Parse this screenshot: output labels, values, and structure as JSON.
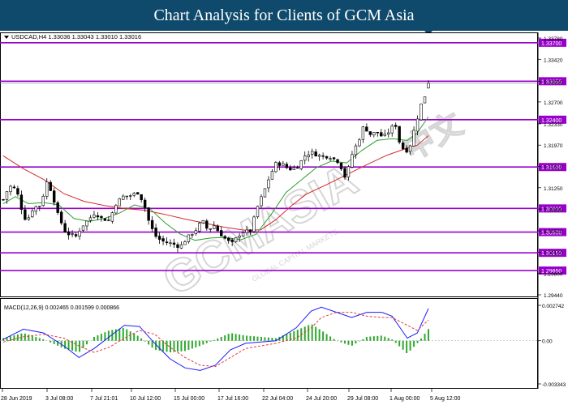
{
  "banner": {
    "title": "Chart Analysis for Clients of GCM Asia"
  },
  "watermark": {
    "brand": "GCMASIA",
    "tagline": "GLOBAL CAPITAL MARKETS",
    "chinese": "中文"
  },
  "price_chart": {
    "header": "USDCAD,H4  1.33036 1.33043 1.33010 1.33016",
    "axis_ticks": [
      "1.33780",
      "1.33420",
      "1.33050",
      "1.32700",
      "1.32330",
      "1.31970",
      "1.31610",
      "1.31250",
      "1.30890",
      "1.30520",
      "1.30160",
      "1.29800",
      "1.29440"
    ],
    "levels": [
      {
        "label": "1.33700",
        "value": 1.337
      },
      {
        "label": "1.33050",
        "value": 1.3305
      },
      {
        "label": "1.32400",
        "value": 1.324
      },
      {
        "label": "1.31600",
        "value": 1.316
      },
      {
        "label": "1.30900",
        "value": 1.309
      },
      {
        "label": "1.30500",
        "value": 1.305
      },
      {
        "label": "1.30150",
        "value": 1.3015
      },
      {
        "label": "1.29850",
        "value": 1.2985
      }
    ],
    "current_price": "1.33016"
  },
  "macd_panel": {
    "header": "MACD(12,26,9) 0.002465 0.001599 0.000866",
    "axis_ticks": [
      "0.002742",
      "0.00",
      "-0.003343"
    ]
  },
  "time_axis": [
    "28 Jun 2019",
    "3 Jul 08:00",
    "7 Jul 21:01",
    "10 Jul 12:00",
    "15 Jul 00:00",
    "17 Jul 16:00",
    "22 Jul 04:00",
    "24 Jul 20:00",
    "29 Jul 08:00",
    "1 Aug 00:00",
    "5 Aug 12:00"
  ],
  "colors": {
    "banner": "#0f4a6c",
    "level_line": "#9900cc",
    "ma_fast": "#2e9e2e",
    "ma_slow": "#d42a2a",
    "macd_main": "#1a1aff",
    "macd_signal": "#e23b3b",
    "histogram": "#2ea82e"
  },
  "chart_data": {
    "type": "candlestick",
    "symbol": "USDCAD",
    "timeframe": "H4",
    "ohlc_last": {
      "open": 1.33036,
      "high": 1.33043,
      "low": 1.3301,
      "close": 1.33016
    },
    "close_path": [
      [
        0,
        1.3105
      ],
      [
        6,
        1.3128
      ],
      [
        13,
        1.3122
      ],
      [
        18,
        1.309
      ],
      [
        23,
        1.3067
      ],
      [
        30,
        1.3092
      ],
      [
        37,
        1.3095
      ],
      [
        43,
        1.3135
      ],
      [
        48,
        1.3118
      ],
      [
        54,
        1.308
      ],
      [
        62,
        1.3048
      ],
      [
        72,
        1.3043
      ],
      [
        78,
        1.306
      ],
      [
        85,
        1.3072
      ],
      [
        91,
        1.3083
      ],
      [
        96,
        1.3074
      ],
      [
        105,
        1.3069
      ],
      [
        111,
        1.3097
      ],
      [
        118,
        1.311
      ],
      [
        126,
        1.3112
      ],
      [
        133,
        1.3117
      ],
      [
        139,
        1.31
      ],
      [
        145,
        1.3063
      ],
      [
        152,
        1.304
      ],
      [
        160,
        1.3033
      ],
      [
        168,
        1.303
      ],
      [
        175,
        1.3025
      ],
      [
        183,
        1.3042
      ],
      [
        190,
        1.3052
      ],
      [
        197,
        1.307
      ],
      [
        203,
        1.3052
      ],
      [
        208,
        1.3063
      ],
      [
        213,
        1.3051
      ],
      [
        219,
        1.304
      ],
      [
        226,
        1.303
      ],
      [
        236,
        1.305
      ],
      [
        245,
        1.3052
      ],
      [
        251,
        1.309
      ],
      [
        258,
        1.3118
      ],
      [
        264,
        1.3145
      ],
      [
        270,
        1.3166
      ],
      [
        277,
        1.3164
      ],
      [
        283,
        1.3156
      ],
      [
        291,
        1.316
      ],
      [
        299,
        1.318
      ],
      [
        305,
        1.3185
      ],
      [
        311,
        1.318
      ],
      [
        317,
        1.3178
      ],
      [
        323,
        1.3178
      ],
      [
        331,
        1.317
      ],
      [
        336,
        1.3155
      ],
      [
        339,
        1.314
      ],
      [
        346,
        1.3185
      ],
      [
        352,
        1.3205
      ],
      [
        357,
        1.323
      ],
      [
        363,
        1.3215
      ],
      [
        370,
        1.3219
      ],
      [
        376,
        1.321
      ],
      [
        382,
        1.322
      ],
      [
        388,
        1.3235
      ],
      [
        393,
        1.3197
      ],
      [
        398,
        1.3187
      ],
      [
        402,
        1.319
      ],
      [
        405,
        1.3212
      ],
      [
        409,
        1.3235
      ],
      [
        413,
        1.3263
      ],
      [
        416,
        1.3274
      ],
      [
        419,
        1.3287
      ],
      [
        421,
        1.33
      ]
    ],
    "ma_fast": [
      [
        0,
        1.3098
      ],
      [
        12,
        1.311
      ],
      [
        25,
        1.3098
      ],
      [
        40,
        1.31
      ],
      [
        55,
        1.3096
      ],
      [
        70,
        1.3073
      ],
      [
        85,
        1.3068
      ],
      [
        100,
        1.3073
      ],
      [
        115,
        1.3082
      ],
      [
        130,
        1.3096
      ],
      [
        145,
        1.309
      ],
      [
        160,
        1.3066
      ],
      [
        175,
        1.3047
      ],
      [
        190,
        1.3036
      ],
      [
        205,
        1.304
      ],
      [
        220,
        1.3041
      ],
      [
        235,
        1.3037
      ],
      [
        250,
        1.3046
      ],
      [
        265,
        1.3079
      ],
      [
        280,
        1.3117
      ],
      [
        295,
        1.3138
      ],
      [
        310,
        1.3159
      ],
      [
        325,
        1.317
      ],
      [
        340,
        1.3167
      ],
      [
        355,
        1.3188
      ],
      [
        370,
        1.3205
      ],
      [
        385,
        1.3208
      ],
      [
        400,
        1.3205
      ],
      [
        410,
        1.3218
      ],
      [
        421,
        1.3245
      ]
    ],
    "ma_slow": [
      [
        0,
        1.3179
      ],
      [
        20,
        1.3157
      ],
      [
        40,
        1.3139
      ],
      [
        60,
        1.3115
      ],
      [
        80,
        1.3102
      ],
      [
        100,
        1.3095
      ],
      [
        120,
        1.309
      ],
      [
        140,
        1.3087
      ],
      [
        160,
        1.308
      ],
      [
        180,
        1.3072
      ],
      [
        200,
        1.3065
      ],
      [
        220,
        1.3058
      ],
      [
        240,
        1.3053
      ],
      [
        255,
        1.3054
      ],
      [
        270,
        1.3071
      ],
      [
        285,
        1.3094
      ],
      [
        300,
        1.3114
      ],
      [
        320,
        1.313
      ],
      [
        340,
        1.3147
      ],
      [
        360,
        1.3164
      ],
      [
        380,
        1.318
      ],
      [
        400,
        1.3192
      ],
      [
        410,
        1.3197
      ],
      [
        421,
        1.3213
      ]
    ],
    "macd": {
      "ylim": [
        -0.003343,
        0.002742
      ],
      "main": [
        [
          0,
          0.0001
        ],
        [
          20,
          0.0009
        ],
        [
          40,
          0.0006
        ],
        [
          60,
          -0.0004
        ],
        [
          75,
          -0.0013
        ],
        [
          90,
          -0.0006
        ],
        [
          105,
          0.0003
        ],
        [
          120,
          0.0012
        ],
        [
          135,
          0.0011
        ],
        [
          150,
          -0.0002
        ],
        [
          165,
          -0.0014
        ],
        [
          180,
          -0.0021
        ],
        [
          195,
          -0.0023
        ],
        [
          210,
          -0.0019
        ],
        [
          225,
          -0.0007
        ],
        [
          240,
          -0.0002
        ],
        [
          255,
          -0.0001
        ],
        [
          270,
          0.0
        ],
        [
          290,
          0.001
        ],
        [
          305,
          0.0023
        ],
        [
          315,
          0.0026
        ],
        [
          330,
          0.0022
        ],
        [
          345,
          0.0018
        ],
        [
          360,
          0.0022
        ],
        [
          375,
          0.0022
        ],
        [
          385,
          0.0019
        ],
        [
          400,
          0.0002
        ],
        [
          410,
          0.0006
        ],
        [
          421,
          0.0025
        ]
      ],
      "signal": [
        [
          0,
          -0.0001
        ],
        [
          20,
          0.0003
        ],
        [
          40,
          0.0005
        ],
        [
          60,
          0.0002
        ],
        [
          75,
          -0.0004
        ],
        [
          90,
          -0.0009
        ],
        [
          105,
          -0.0005
        ],
        [
          120,
          0.0002
        ],
        [
          135,
          0.0008
        ],
        [
          150,
          0.0005
        ],
        [
          165,
          -0.0005
        ],
        [
          180,
          -0.0013
        ],
        [
          195,
          -0.0019
        ],
        [
          210,
          -0.002
        ],
        [
          225,
          -0.0013
        ],
        [
          240,
          -0.0006
        ],
        [
          255,
          -0.0004
        ],
        [
          270,
          -0.0002
        ],
        [
          290,
          0.0002
        ],
        [
          305,
          0.001
        ],
        [
          315,
          0.0018
        ],
        [
          330,
          0.0022
        ],
        [
          345,
          0.0022
        ],
        [
          360,
          0.0019
        ],
        [
          375,
          0.0018
        ],
        [
          385,
          0.0018
        ],
        [
          400,
          0.0012
        ],
        [
          410,
          0.0008
        ],
        [
          421,
          0.0016
        ]
      ]
    },
    "bars_count": 118
  }
}
